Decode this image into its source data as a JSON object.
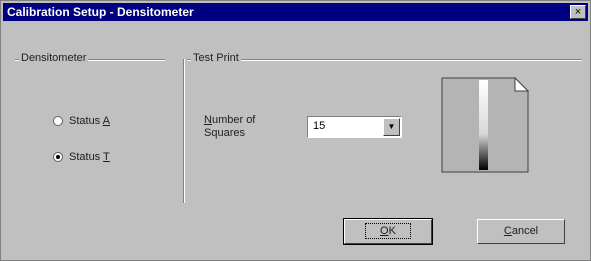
{
  "window": {
    "title": "Calibration Setup - Densitometer",
    "close_label": "×"
  },
  "densitometer_group": {
    "label": "Densitometer",
    "options": [
      {
        "label_prefix": "Status ",
        "label_underlined": "A",
        "selected": false
      },
      {
        "label_prefix": "Status ",
        "label_underlined": "T",
        "selected": true
      }
    ]
  },
  "test_print_group": {
    "label": "Test Print",
    "squares_label_underlined": "N",
    "squares_label_rest_line1": "umber of",
    "squares_label_line2": "Squares",
    "squares_value": "15",
    "dropdown_arrow": "▼"
  },
  "buttons": {
    "ok_underlined": "O",
    "ok_rest": "K",
    "cancel_underlined": "C",
    "cancel_rest": "ancel"
  }
}
